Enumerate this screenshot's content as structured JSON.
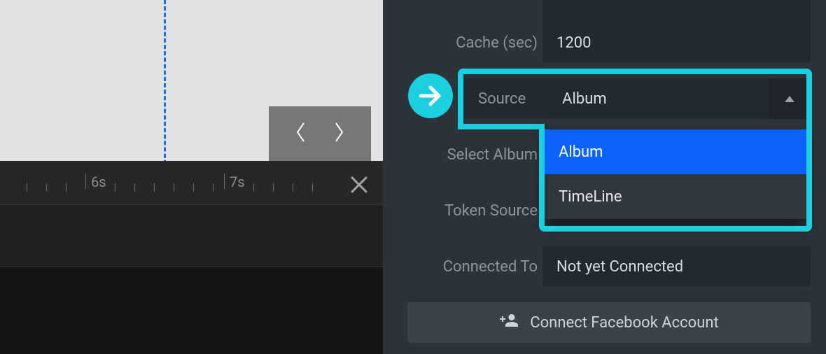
{
  "timeline": {
    "tick_6": "6s",
    "tick_7": "7s"
  },
  "panel": {
    "cache": {
      "label": "Cache (sec)",
      "value": "1200"
    },
    "source": {
      "label": "Source",
      "value": "Album",
      "options": [
        "Album",
        "TimeLine"
      ]
    },
    "select_album": {
      "label": "Select Album"
    },
    "token_source": {
      "label": "Token Source"
    },
    "connected": {
      "label": "Connected To",
      "value": "Not yet Connected"
    },
    "connect_btn": "Connect Facebook Account"
  }
}
